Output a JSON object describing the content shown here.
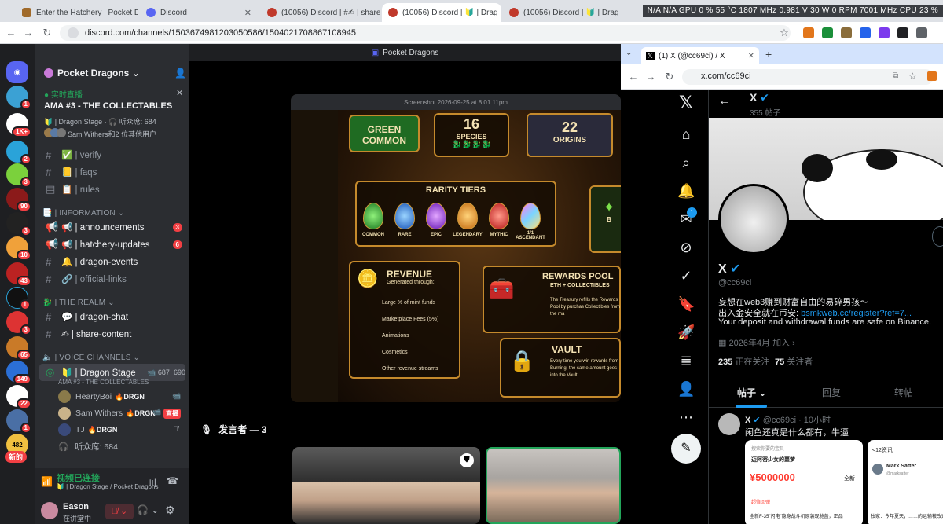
{
  "browser": {
    "tabs": [
      {
        "title": "Enter the Hatchery | Pocket Dragons",
        "fav": "#a06a2a"
      },
      {
        "title": "Discord",
        "fav": "#5865f2"
      },
      {
        "title": "(10056) Discord | #✍ | share",
        "fav": "#5865f2"
      },
      {
        "title": "(10056) Discord | 🔰 | Drag",
        "fav": "#5865f2"
      },
      {
        "title": "(10056) Discord | 🔰 | Dragon",
        "fav": "#5865f2"
      }
    ],
    "perf_text": "N/A  N/A   GPU 0 %  55 °C  1807 MHz  0.981 V  30 W  0 RPM  7001 MHz    CPU 23 %",
    "url": "discord.com/channels/1503674981203050586/1504021708867108945"
  },
  "discord": {
    "server_name": "Pocket Dragons",
    "live_label": "实时直播",
    "live_title": "AMA #3 - THE COLLECTABLES",
    "live_meta": "🔰 | Dragon Stage · 🎧 听众席: 684",
    "live_users": "Sam Withers和2 位其他用户",
    "channels_top": [
      {
        "name": "✅ | verify"
      },
      {
        "name": "📒 | faqs"
      },
      {
        "name": "📋 | rules"
      }
    ],
    "cat_information": "📑 | INFORMATION",
    "channels_info": [
      {
        "name": "📢 | announcements",
        "badge": "3"
      },
      {
        "name": "📢 | hatchery-updates",
        "badge": "6"
      },
      {
        "name": "🔔 | dragon-events",
        "badge": ""
      },
      {
        "name": "🔗 | official-links",
        "badge": ""
      }
    ],
    "cat_realm": "🐉 | THE REALM",
    "channels_realm": [
      {
        "name": "💬 | dragon-chat"
      },
      {
        "name": "✍ | share-content"
      }
    ],
    "cat_voice": "🔈 | VOICE CHANNELS",
    "stage_channel": "🔰 | Dragon Stage",
    "stage_count_a": "687",
    "stage_count_b": "690",
    "stage_sub": "AMA #3 - THE COLLECTABLES",
    "voice_users": [
      {
        "name": "HeartyBoi",
        "tag": "🔥DRGN",
        "live": ""
      },
      {
        "name": "Sam Withers",
        "tag": "🔥DRGN",
        "live": "直播"
      },
      {
        "name": "TJ",
        "tag": "🔥DRGN",
        "live": ""
      }
    ],
    "audience": "听众席: 684",
    "guild_badges": [
      "1",
      "1K+",
      "2",
      "3",
      "90",
      "3",
      "10",
      "43",
      "1",
      "3",
      "65",
      "149",
      "22",
      "1"
    ],
    "new_label": "新的",
    "voice_connected": "视频已连接",
    "voice_location": "🔰 | Dragon Stage / Pocket Dragons",
    "user_name": "Eason",
    "user_status": "在讲堂中",
    "stage_window_title": "Pocket Dragons",
    "share_caption": "Screenshot 2026-09-25 at 8.01.11pm",
    "speakers_label": "发言者 — 3"
  },
  "infographic": {
    "green_common": "GREEN COMMON",
    "species_num": "16",
    "species_lbl": "SPECIES",
    "origins_num": "22",
    "origins_lbl": "ORIGINS",
    "rarity_title": "RARITY TIERS",
    "tiers": [
      "COMMON",
      "RARE",
      "EPIC",
      "LEGENDARY",
      "MYTHIC",
      "1/1 ASCENDANT"
    ],
    "revenue_title": "REVENUE",
    "revenue_sub": "Generated through:",
    "revenue_items": [
      "Large % of mint funds",
      "Marketplace Fees (5%)",
      "Animations",
      "Cosmetics",
      "Other revenue streams"
    ],
    "pool_title": "REWARDS POOL",
    "pool_sub": "ETH + COLLECTIBLES",
    "pool_text": "The Treasury refills the Rewards Pool by purchas Collectibles from the ma",
    "vault_title": "VAULT",
    "vault_text": "Every time you win rewards from Burning, the same amount goes into the Vault.",
    "b_label": "B"
  },
  "xwindow": {
    "tab_title": "(1) X (@cc69ci) / X",
    "url": "x.com/cc69ci",
    "nav_badge": "1",
    "header_name": "X",
    "header_posts": "355 帖子",
    "display_name": "X",
    "handle": "@cc69ci",
    "bio1": "妄想在web3赚到财富自由的易碎男孩～",
    "bio2_prefix": "出入金安全就在币安: ",
    "bio2_link": "bsmkweb.cc/register?ref=7...",
    "bio3": "Your deposit and withdrawal funds are safe on Binance.",
    "joined": "2026年4月 加入",
    "following_num": "235",
    "following_lbl": "正在关注",
    "followers_num": "75",
    "followers_lbl": "关注者",
    "tabs": [
      "帖子",
      "回复",
      "转帖"
    ],
    "post_name": "X",
    "post_handle": "@cc69ci · 10小时",
    "post_text": "闲鱼还真是什么都有，牛逼",
    "img1_search": "搜索你要的宝贝",
    "img1_title": "迈阿密少女的噩梦",
    "img1_price": "¥5000000",
    "img1_new": "全新",
    "img1_tag": "超值回弹",
    "img1_foot": "全新F-35\"闪电\"隐身战斗机原装现舱盖，正品",
    "img2_head": "<12资讯",
    "img2_name": "Mark Satter",
    "img2_handle": "@marksatter",
    "img2_foot": "独家：今年夏天，……的运输被改道至香港…"
  },
  "colors": {
    "discord_accent": "#5865f2",
    "live_green": "#23a55a",
    "badge_red": "#f23f43",
    "x_blue": "#1d9bf0",
    "gold": "#c58a2c"
  }
}
